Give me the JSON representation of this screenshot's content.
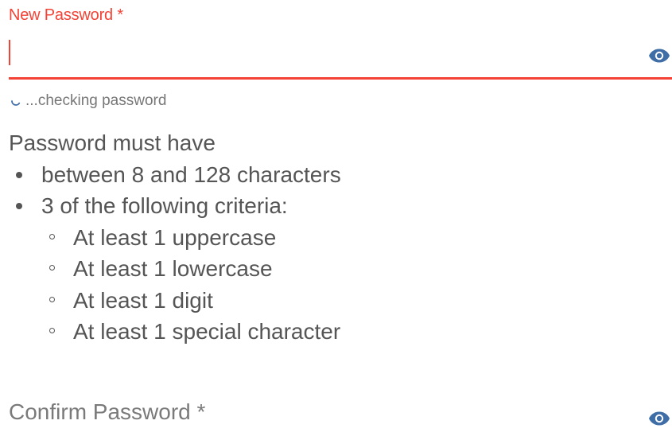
{
  "new_password": {
    "label": "New Password *",
    "value": "",
    "toggle_icon": "eye-icon",
    "status_text": "...checking password",
    "status_icon": "spinner-icon"
  },
  "rules": {
    "title": "Password must have",
    "items": [
      "between 8 and 128 characters",
      "3 of the following criteria:"
    ],
    "criteria": [
      "At least 1 uppercase",
      "At least 1 lowercase",
      "At least 1 digit",
      "At least 1 special character"
    ]
  },
  "confirm_password": {
    "label": "Confirm Password *",
    "value": "",
    "toggle_icon": "eye-icon"
  },
  "colors": {
    "error_accent": "#f44336",
    "icon_blue": "#3f6da6",
    "text": "#555555",
    "muted": "#7a7a7a"
  }
}
